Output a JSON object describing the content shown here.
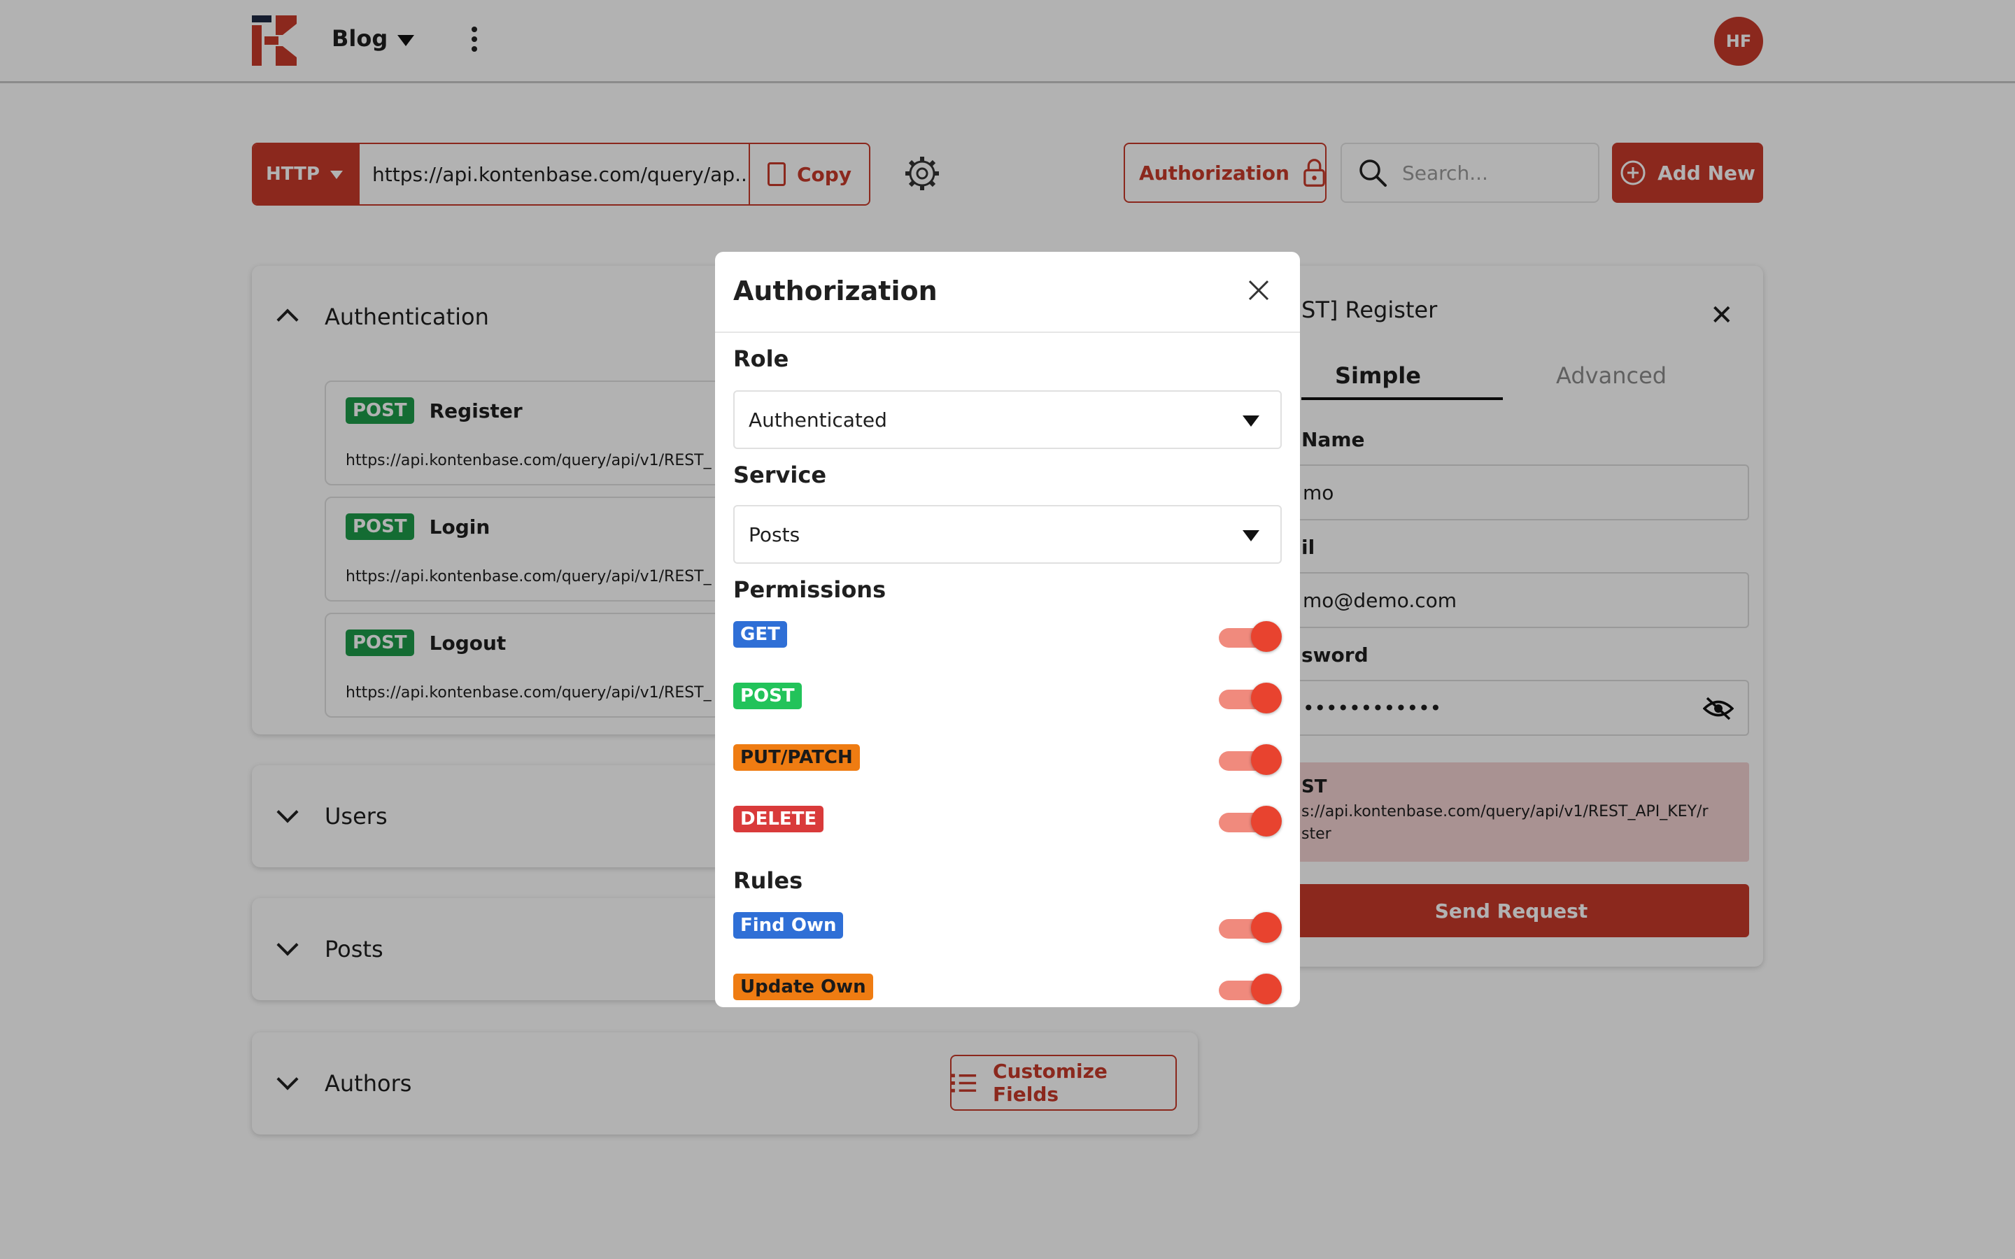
{
  "topbar": {
    "project_name": "Blog",
    "avatar_initials": "HF"
  },
  "toolbar": {
    "method": "HTTP",
    "url": "https://api.kontenbase.com/query/ap...",
    "copy_label": "Copy",
    "authorization_label": "Authorization",
    "search_placeholder": "Search...",
    "add_new_label": "Add New"
  },
  "sections": {
    "authentication": {
      "title": "Authentication",
      "endpoints": [
        {
          "method": "POST",
          "name": "Register",
          "url": "https://api.kontenbase.com/query/api/v1/REST_"
        },
        {
          "method": "POST",
          "name": "Login",
          "url": "https://api.kontenbase.com/query/api/v1/REST_"
        },
        {
          "method": "POST",
          "name": "Logout",
          "url": "https://api.kontenbase.com/query/api/v1/REST_"
        }
      ]
    },
    "users": {
      "title": "Users"
    },
    "posts": {
      "title": "Posts"
    },
    "authors": {
      "title": "Authors",
      "customize_label": "Customize Fields"
    }
  },
  "request_panel": {
    "title": "ST] Register",
    "tabs": [
      "Simple",
      "Advanced"
    ],
    "fields": [
      {
        "label": "Name",
        "value": "mo"
      },
      {
        "label": "il",
        "value": "mo@demo.com"
      },
      {
        "label": "sword",
        "value": "••••••••••••"
      }
    ],
    "request_method": "ST",
    "request_url_line1": "s://api.kontenbase.com/query/api/v1/REST_API_KEY/r",
    "request_url_line2": "ster",
    "send_label": "Send Request"
  },
  "modal": {
    "title": "Authorization",
    "role_label": "Role",
    "role_value": "Authenticated",
    "service_label": "Service",
    "service_value": "Posts",
    "permissions_label": "Permissions",
    "permissions": [
      {
        "label": "GET",
        "enabled": true
      },
      {
        "label": "POST",
        "enabled": true
      },
      {
        "label": "PUT/PATCH",
        "enabled": true
      },
      {
        "label": "DELETE",
        "enabled": true
      }
    ],
    "rules_label": "Rules",
    "rules": [
      {
        "label": "Find Own",
        "enabled": true
      },
      {
        "label": "Update Own",
        "enabled": true
      }
    ]
  },
  "colors": {
    "accent": "#c83a2a",
    "get": "#2f6fd6",
    "post": "#1e9b4a",
    "put": "#ef7c12",
    "delete": "#d93a3a"
  }
}
